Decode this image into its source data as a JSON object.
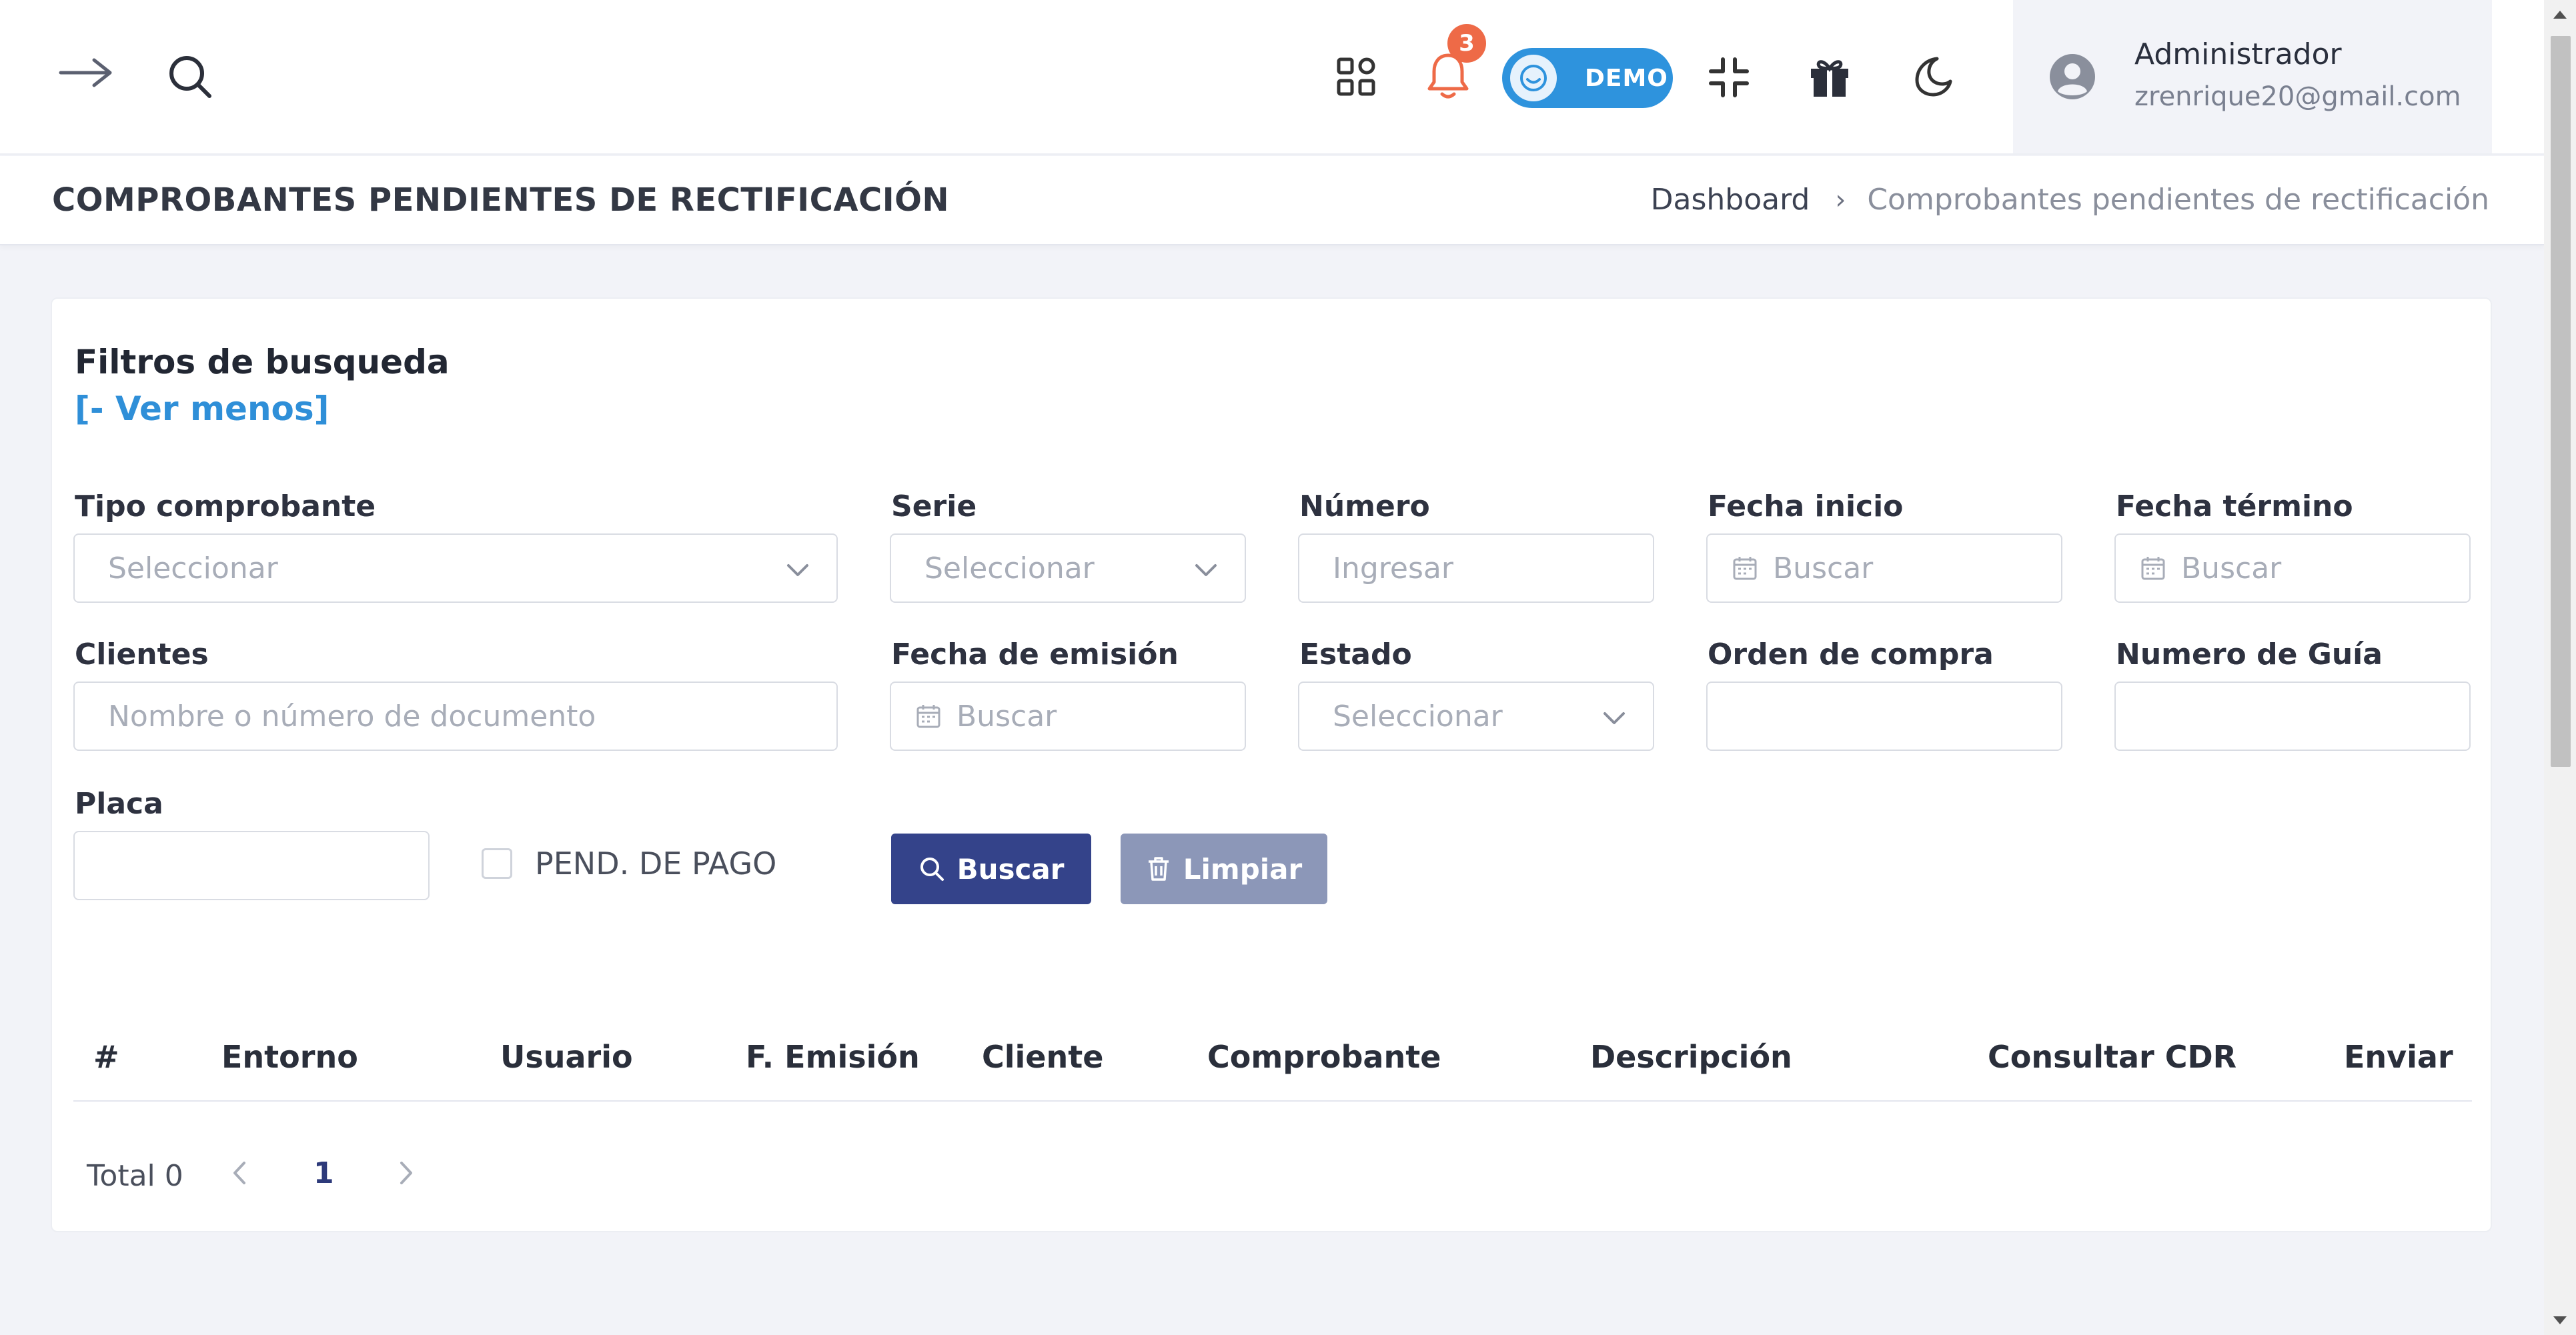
{
  "topbar": {
    "notification_count": "3",
    "demo_label": "DEMO",
    "user_name": "Administrador",
    "user_email": "zrenrique20@gmail.com"
  },
  "header": {
    "title": "COMPROBANTES PENDIENTES DE RECTIFICACIÓN",
    "breadcrumb_home": "Dashboard",
    "breadcrumb_sep": "›",
    "breadcrumb_current": "Comprobantes pendientes de rectificación"
  },
  "filters": {
    "title": "Filtros de busqueda",
    "toggle": "[- Ver menos]",
    "tipo_label": "Tipo comprobante",
    "tipo_placeholder": "Seleccionar",
    "serie_label": "Serie",
    "serie_placeholder": "Seleccionar",
    "numero_label": "Número",
    "numero_placeholder": "Ingresar",
    "fecha_inicio_label": "Fecha inicio",
    "fecha_inicio_placeholder": "Buscar",
    "fecha_termino_label": "Fecha término",
    "fecha_termino_placeholder": "Buscar",
    "clientes_label": "Clientes",
    "clientes_placeholder": "Nombre o número de documento",
    "fecha_emision_label": "Fecha de emisión",
    "fecha_emision_placeholder": "Buscar",
    "estado_label": "Estado",
    "estado_placeholder": "Seleccionar",
    "orden_label": "Orden de compra",
    "guia_label": "Numero de Guía",
    "placa_label": "Placa",
    "pend_pago_label": "PEND. DE PAGO",
    "search_button": "Buscar",
    "clear_button": "Limpiar"
  },
  "table": {
    "columns": [
      "#",
      "Entorno",
      "Usuario",
      "F. Emisión",
      "Cliente",
      "Comprobante",
      "Descripción",
      "Consultar CDR",
      "Enviar"
    ]
  },
  "pagination": {
    "total_label": "Total 0",
    "current_page": "1"
  },
  "colors": {
    "primary_button": "#34438a",
    "secondary_button": "#8c97b8",
    "link": "#2f8fd8",
    "demo_pill": "#2e93dd",
    "badge": "#ee6a47"
  },
  "icons": [
    "arrow-right-icon",
    "search-icon",
    "apps-grid-icon",
    "bell-icon",
    "smile-icon",
    "compress-icon",
    "gift-icon",
    "moon-icon",
    "user-avatar-icon",
    "calendar-icon",
    "chevron-down-icon",
    "trash-icon",
    "chevron-left-icon",
    "chevron-right-icon"
  ]
}
